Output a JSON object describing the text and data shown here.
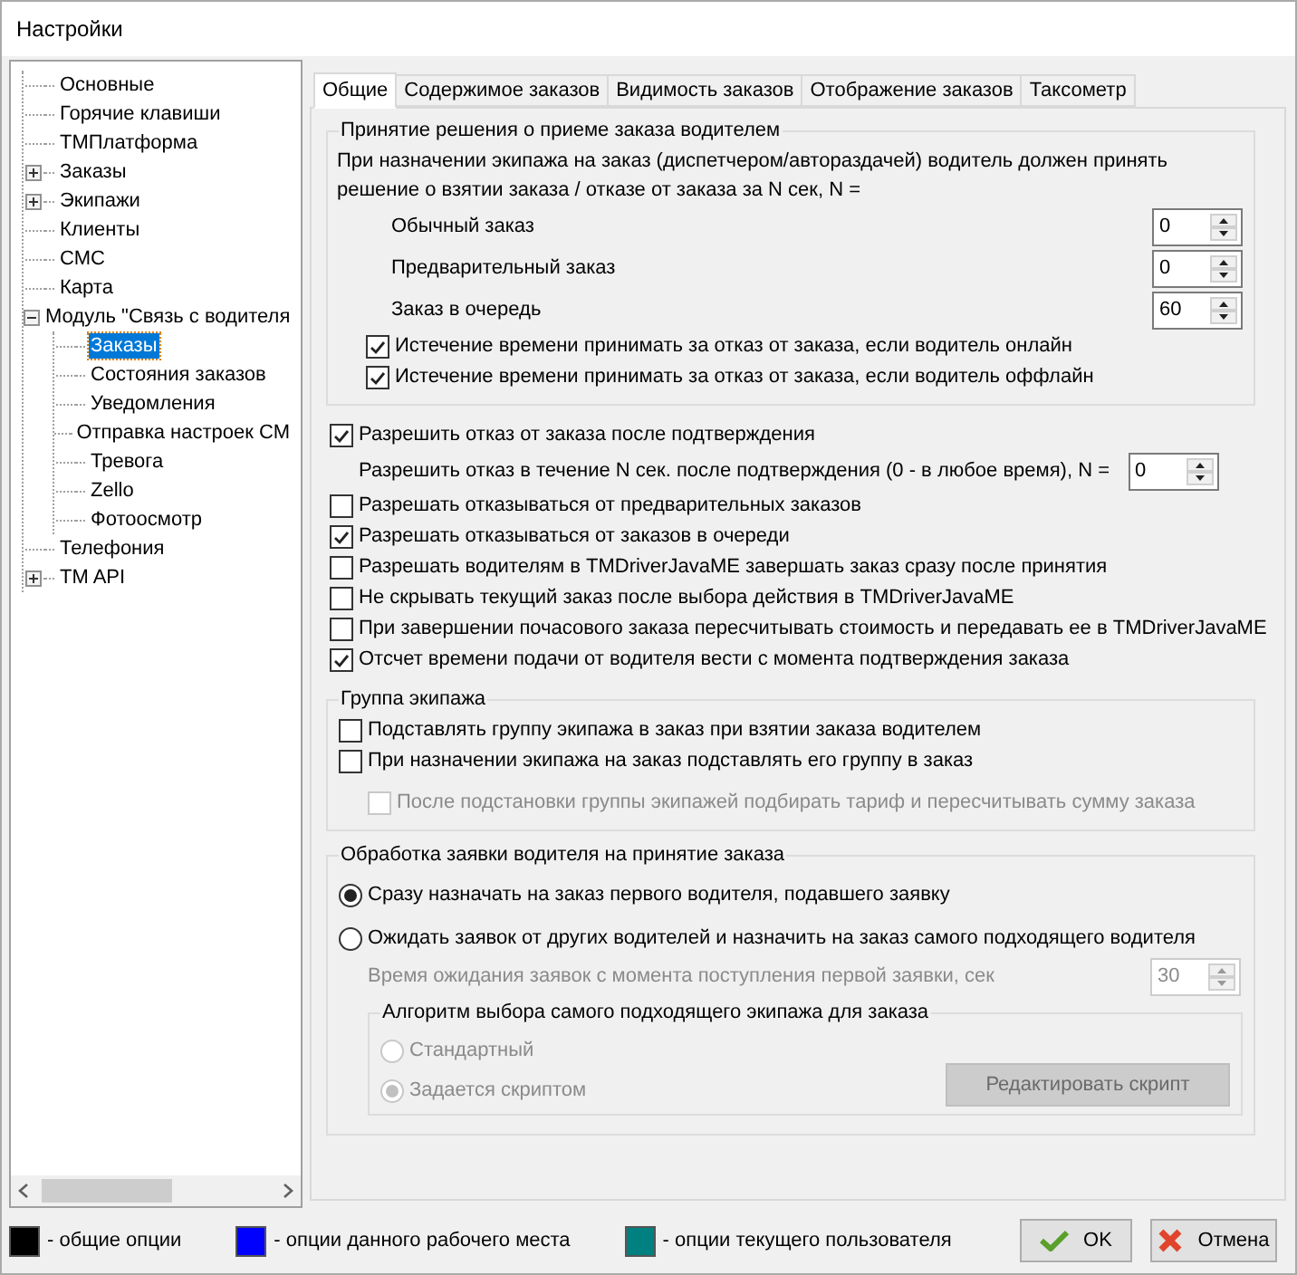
{
  "window": {
    "title": "Настройки"
  },
  "tree": {
    "items": [
      {
        "label": "Основные",
        "selected": false
      },
      {
        "label": "Горячие клавиши",
        "selected": false
      },
      {
        "label": "TMПлатформа",
        "selected": false
      },
      {
        "label": "Заказы",
        "selected": false,
        "expanded": false
      },
      {
        "label": "Экипажи",
        "selected": false,
        "expanded": false
      },
      {
        "label": "Клиенты",
        "selected": false
      },
      {
        "label": "СМС",
        "selected": false
      },
      {
        "label": "Карта",
        "selected": false
      },
      {
        "label": "Модуль \"Связь с водителя",
        "selected": false,
        "expanded": true,
        "children": [
          {
            "label": "Заказы",
            "selected": true
          },
          {
            "label": "Состояния заказов",
            "selected": false
          },
          {
            "label": "Уведомления",
            "selected": false
          },
          {
            "label": "Отправка настроек СМ",
            "selected": false
          },
          {
            "label": "Тревога",
            "selected": false
          },
          {
            "label": "Zello",
            "selected": false
          },
          {
            "label": "Фотоосмотр",
            "selected": false
          }
        ]
      },
      {
        "label": "Телефония",
        "selected": false
      },
      {
        "label": "TM API",
        "selected": false,
        "expanded": false
      }
    ]
  },
  "tabs": [
    {
      "label": "Общие",
      "selected": true
    },
    {
      "label": "Содержимое заказов",
      "selected": false
    },
    {
      "label": "Видимость заказов",
      "selected": false
    },
    {
      "label": "Отображение заказов",
      "selected": false
    },
    {
      "label": "Таксометр",
      "selected": false
    }
  ],
  "decision_group": {
    "title": "Принятие решения о приеме заказа водителем",
    "description": "При назначении экипажа на заказ (диспетчером/автораздачей) водитель должен принять решение о взятии заказа / отказе от заказа за N сек, N =",
    "spins": [
      {
        "label": "Обычный заказ",
        "value": "0"
      },
      {
        "label": "Предварительный заказ",
        "value": "0"
      },
      {
        "label": "Заказ в очередь",
        "value": "60"
      }
    ],
    "checkboxes": [
      {
        "label": "Истечение времени принимать за отказ от заказа, если водитель онлайн",
        "checked": true
      },
      {
        "label": "Истечение времени принимать за отказ от заказа, если водитель оффлайн",
        "checked": true
      }
    ]
  },
  "options": [
    {
      "kind": "checkbox",
      "label": "Разрешить отказ от заказа после подтверждения",
      "checked": true
    },
    {
      "kind": "spin",
      "label": "Разрешить отказ в течение N сек. после подтверждения (0 - в любое время), N =",
      "value": "0"
    },
    {
      "kind": "checkbox",
      "label": "Разрешать отказываться от предварительных заказов",
      "checked": false
    },
    {
      "kind": "checkbox",
      "label": "Разрешать отказываться от заказов в очереди",
      "checked": true
    },
    {
      "kind": "checkbox",
      "label": "Разрешать водителям в TMDriverJavaME завершать заказ сразу после принятия",
      "checked": false
    },
    {
      "kind": "checkbox",
      "label": "Не скрывать текущий заказ после  выбора действия в TMDriverJavaME",
      "checked": false
    },
    {
      "kind": "checkbox",
      "label": "При завершении почасового заказа пересчитывать стоимость и передавать ее в TMDriverJavaME",
      "checked": false
    },
    {
      "kind": "checkbox",
      "label": "Отсчет времени подачи от водителя вести с момента подтверждения заказа",
      "checked": true
    }
  ],
  "crew_group": {
    "title": "Группа экипажа",
    "checkboxes": [
      {
        "label": "Подставлять группу экипажа в заказ при взятии заказа водителем",
        "checked": false,
        "disabled": false
      },
      {
        "label": "При назначении экипажа на заказ подставлять его группу в заказ",
        "checked": false,
        "disabled": false,
        "children": [
          {
            "label": "После подстановки группы экипажей подбирать тариф и пересчитывать сумму заказа",
            "checked": false,
            "disabled": true
          }
        ]
      }
    ]
  },
  "request_group": {
    "title": "Обработка заявки водителя на принятие заказа",
    "radios": [
      {
        "label": "Сразу назначать на заказ первого водителя, подавшего заявку",
        "selected": true
      },
      {
        "label": "Ожидать заявок от других водителей и назначить на заказ самого подходящего водителя",
        "selected": false
      }
    ],
    "wait_spin": {
      "label": "Время ожидания заявок с момента поступления первой заявки, сек",
      "value": "30",
      "disabled": true
    },
    "algorithm": {
      "title": "Алгоритм выбора самого подходящего экипажа для заказа",
      "radios": [
        {
          "label": "Стандартный",
          "selected": false,
          "disabled": true
        },
        {
          "label": "Задается скриптом",
          "selected": true,
          "disabled": true
        }
      ],
      "button": {
        "label": "Редактировать скрипт",
        "disabled": true
      }
    }
  },
  "legend": [
    {
      "color": "#000000",
      "label": "- общие опции"
    },
    {
      "color": "#0000ff",
      "label": "- опции данного рабочего места"
    },
    {
      "color": "#008080",
      "label": "- опции текущего пользователя"
    }
  ],
  "buttons": [
    {
      "kind": "ok",
      "label": "OK"
    },
    {
      "kind": "cancel",
      "label": "Отмена"
    }
  ]
}
